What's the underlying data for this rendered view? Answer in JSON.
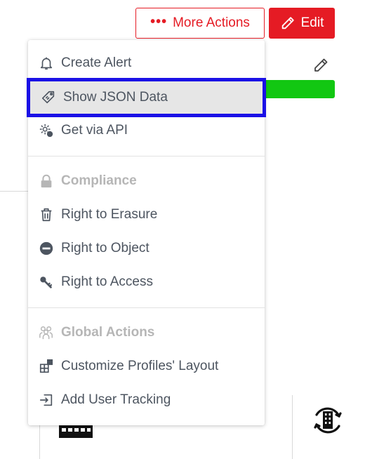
{
  "header": {
    "more_actions_label": "More Actions",
    "edit_label": "Edit",
    "accent_color": "#e51b24"
  },
  "menu": {
    "items": [
      {
        "label": "Create Alert",
        "icon": "bell-icon"
      },
      {
        "label": "Show JSON Data",
        "icon": "tag-icon",
        "selected": true
      },
      {
        "label": "Get via API",
        "icon": "gear-info-icon"
      }
    ],
    "compliance": {
      "title": "Compliance",
      "icon": "lock-icon",
      "items": [
        {
          "label": "Right to Erasure",
          "icon": "trash-icon"
        },
        {
          "label": "Right to Object",
          "icon": "minus-circle-icon"
        },
        {
          "label": "Right to Access",
          "icon": "key-icon"
        }
      ]
    },
    "global_actions": {
      "title": "Global Actions",
      "icon": "users-icon",
      "items": [
        {
          "label": "Customize Profiles' Layout",
          "icon": "layout-icon"
        },
        {
          "label": "Add User Tracking",
          "icon": "sign-in-icon"
        }
      ]
    }
  },
  "colors": {
    "selection_outline": "#1a10e6",
    "status_bar": "#12c712"
  }
}
